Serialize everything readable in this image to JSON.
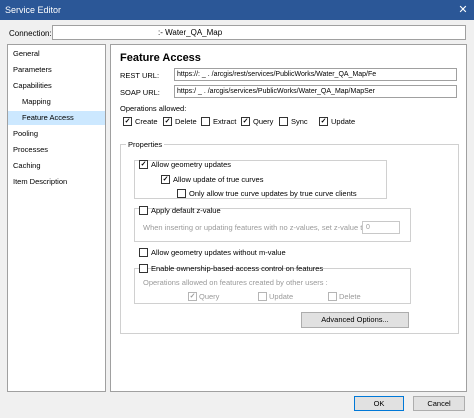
{
  "window": {
    "title": "Service Editor",
    "close_glyph": "✕"
  },
  "connection": {
    "label": "Connection:",
    "value": "​:- Water_QA_Map"
  },
  "sidebar": {
    "items": [
      {
        "label": "General"
      },
      {
        "label": "Parameters"
      },
      {
        "label": "Capabilities"
      },
      {
        "label": "Mapping"
      },
      {
        "label": "Feature Access"
      },
      {
        "label": "Pooling"
      },
      {
        "label": "Processes"
      },
      {
        "label": "Caching"
      },
      {
        "label": "Item Description"
      }
    ]
  },
  "main": {
    "title": "Feature Access",
    "rest": {
      "label": "REST URL:",
      "value": "https://:          _      .           /arcgis/rest/services/PublicWorks/Water_QA_Map/Fe"
    },
    "soap": {
      "label": "SOAP URL:",
      "value": "https:/           _      .           /arcgis/services/PublicWorks/Water_QA_Map/MapSer"
    },
    "ops_label": "Operations allowed:",
    "ops": [
      {
        "label": "Create",
        "checked": true
      },
      {
        "label": "Delete",
        "checked": true
      },
      {
        "label": "Extract",
        "checked": false
      },
      {
        "label": "Query",
        "checked": true
      },
      {
        "label": "Sync",
        "checked": false
      },
      {
        "label": "Update",
        "checked": true
      }
    ],
    "properties": {
      "title": "Properties",
      "allow_geometry_updates": "Allow geometry updates",
      "allow_true_curves": "Allow update of true curves",
      "only_true_curve_clients": "Only allow true curve updates by true curve clients",
      "apply_default_z": "Apply default z-value",
      "z_hint": "When inserting or updating features with no z-values, set z-value to:",
      "z_value": "0",
      "allow_without_m": "Allow geometry updates without m-value",
      "ownership": "Enable ownership-based access control on features",
      "ownership_hint": "Operations allowed on features created by other users :",
      "owner_ops": [
        {
          "label": "Query"
        },
        {
          "label": "Update"
        },
        {
          "label": "Delete"
        }
      ],
      "advanced": "Advanced Options..."
    }
  },
  "footer": {
    "ok": "OK",
    "cancel": "Cancel"
  },
  "check_glyph": "✓"
}
